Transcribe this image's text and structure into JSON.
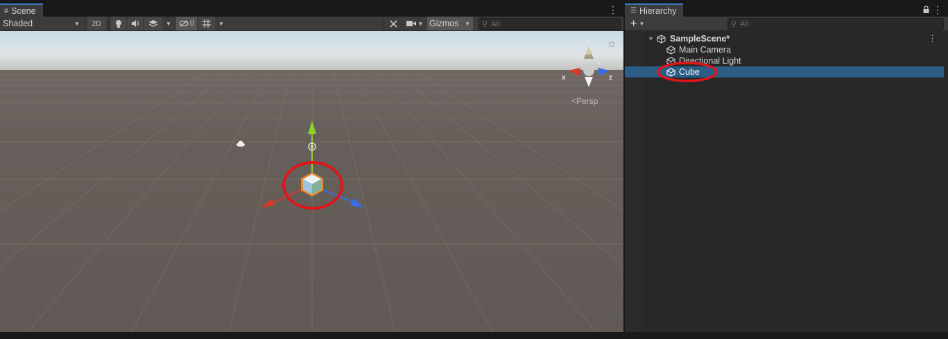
{
  "scene": {
    "tab_label": "Scene",
    "tab_icon": "grid-hash-icon",
    "shading_mode": "Shaded",
    "btn_2d": "2D",
    "hidden_count": "0",
    "gizmos_label": "Gizmos",
    "search_placeholder": "All",
    "projection_label": "Persp",
    "axis_x": "x",
    "axis_y": "y",
    "axis_z": "z"
  },
  "hierarchy": {
    "tab_label": "Hierarchy",
    "tab_icon": "list-icon",
    "add_label": "+",
    "search_placeholder": "All",
    "scene_name": "SampleScene*",
    "items": [
      {
        "label": "Main Camera",
        "icon": "gameobject-cube-icon",
        "selected": false
      },
      {
        "label": "Directional Light",
        "icon": "gameobject-cube-icon",
        "selected": false
      },
      {
        "label": "Cube",
        "icon": "gameobject-cube-icon",
        "selected": true
      }
    ]
  },
  "colors": {
    "selection": "#2c5d87",
    "tab_accent": "#3a79bb",
    "highlight_ring": "#e0151b",
    "axis_x": "#d63a2a",
    "axis_y": "#8ed12b",
    "axis_z": "#3b6ee6"
  }
}
